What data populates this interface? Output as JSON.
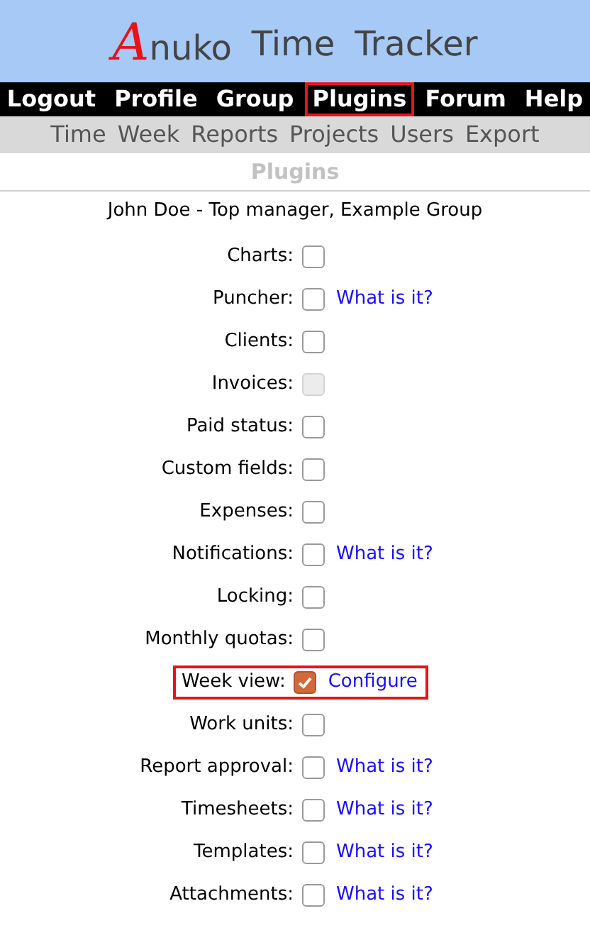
{
  "logo": {
    "initial": "A",
    "rest": "nuko",
    "words": [
      "Time",
      "Tracker"
    ]
  },
  "main_menu": [
    {
      "label": "Logout",
      "highlighted": false
    },
    {
      "label": "Profile",
      "highlighted": false
    },
    {
      "label": "Group",
      "highlighted": false
    },
    {
      "label": "Plugins",
      "highlighted": true
    },
    {
      "label": "Forum",
      "highlighted": false
    },
    {
      "label": "Help",
      "highlighted": false
    }
  ],
  "sub_menu": [
    "Time",
    "Week",
    "Reports",
    "Projects",
    "Users",
    "Export"
  ],
  "page_title": "Plugins",
  "user_line": "John Doe - Top manager, Example Group",
  "plugins": [
    {
      "label": "Charts:",
      "checked": false,
      "disabled": false,
      "highlighted": false
    },
    {
      "label": "Puncher:",
      "checked": false,
      "disabled": false,
      "highlighted": false,
      "link": "What is it?"
    },
    {
      "label": "Clients:",
      "checked": false,
      "disabled": false,
      "highlighted": false
    },
    {
      "label": "Invoices:",
      "checked": false,
      "disabled": true,
      "highlighted": false
    },
    {
      "label": "Paid status:",
      "checked": false,
      "disabled": false,
      "highlighted": false
    },
    {
      "label": "Custom fields:",
      "checked": false,
      "disabled": false,
      "highlighted": false
    },
    {
      "label": "Expenses:",
      "checked": false,
      "disabled": false,
      "highlighted": false
    },
    {
      "label": "Notifications:",
      "checked": false,
      "disabled": false,
      "highlighted": false,
      "link": "What is it?"
    },
    {
      "label": "Locking:",
      "checked": false,
      "disabled": false,
      "highlighted": false
    },
    {
      "label": "Monthly quotas:",
      "checked": false,
      "disabled": false,
      "highlighted": false
    },
    {
      "label": "Week view:",
      "checked": true,
      "disabled": false,
      "highlighted": true,
      "link": "Configure"
    },
    {
      "label": "Work units:",
      "checked": false,
      "disabled": false,
      "highlighted": false
    },
    {
      "label": "Report approval:",
      "checked": false,
      "disabled": false,
      "highlighted": false,
      "link": "What is it?"
    },
    {
      "label": "Timesheets:",
      "checked": false,
      "disabled": false,
      "highlighted": false,
      "link": "What is it?"
    },
    {
      "label": "Templates:",
      "checked": false,
      "disabled": false,
      "highlighted": false,
      "link": "What is it?"
    },
    {
      "label": "Attachments:",
      "checked": false,
      "disabled": false,
      "highlighted": false,
      "link": "What is it?"
    }
  ]
}
